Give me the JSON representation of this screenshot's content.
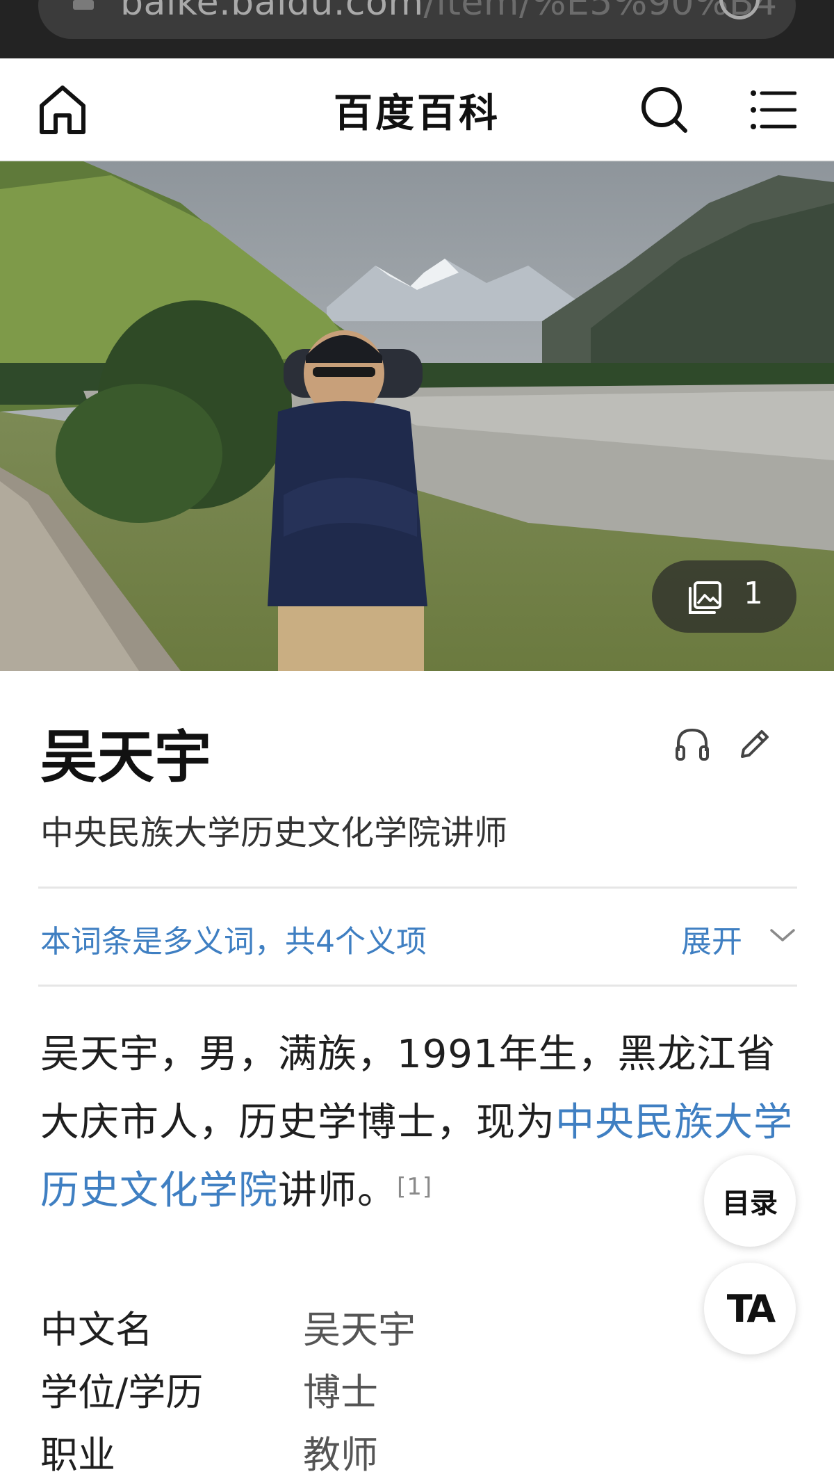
{
  "browser": {
    "url_visible": "baike.baidu.com",
    "url_path_tail": "/item/%E5%90%B4"
  },
  "header": {
    "title": "百度百科",
    "icons": [
      "home-icon",
      "search-icon",
      "menu-icon"
    ]
  },
  "hero": {
    "gallery_count": "1"
  },
  "entry": {
    "title": "吴天宇",
    "subtitle": "中央民族大学历史文化学院讲师",
    "polysemy_text": "本词条是多义词，共4个义项",
    "expand_label": "展开",
    "summary_prefix": "吴天宇，男，满族，1991年生，黑龙江省大庆市人，历史学博士，现为",
    "summary_link": "中央民族大学历史文化学院",
    "summary_suffix": "讲师。",
    "citation": "[1]"
  },
  "floating": {
    "toc_label": "目录",
    "ta_label": "TA"
  },
  "infobox": [
    {
      "label": "中文名",
      "value": "吴天宇"
    },
    {
      "label": "学位/学历",
      "value": "博士"
    },
    {
      "label": "职业",
      "value": "教师"
    }
  ],
  "colors": {
    "link": "#3f7fc2",
    "browser_bar": "#232323"
  }
}
